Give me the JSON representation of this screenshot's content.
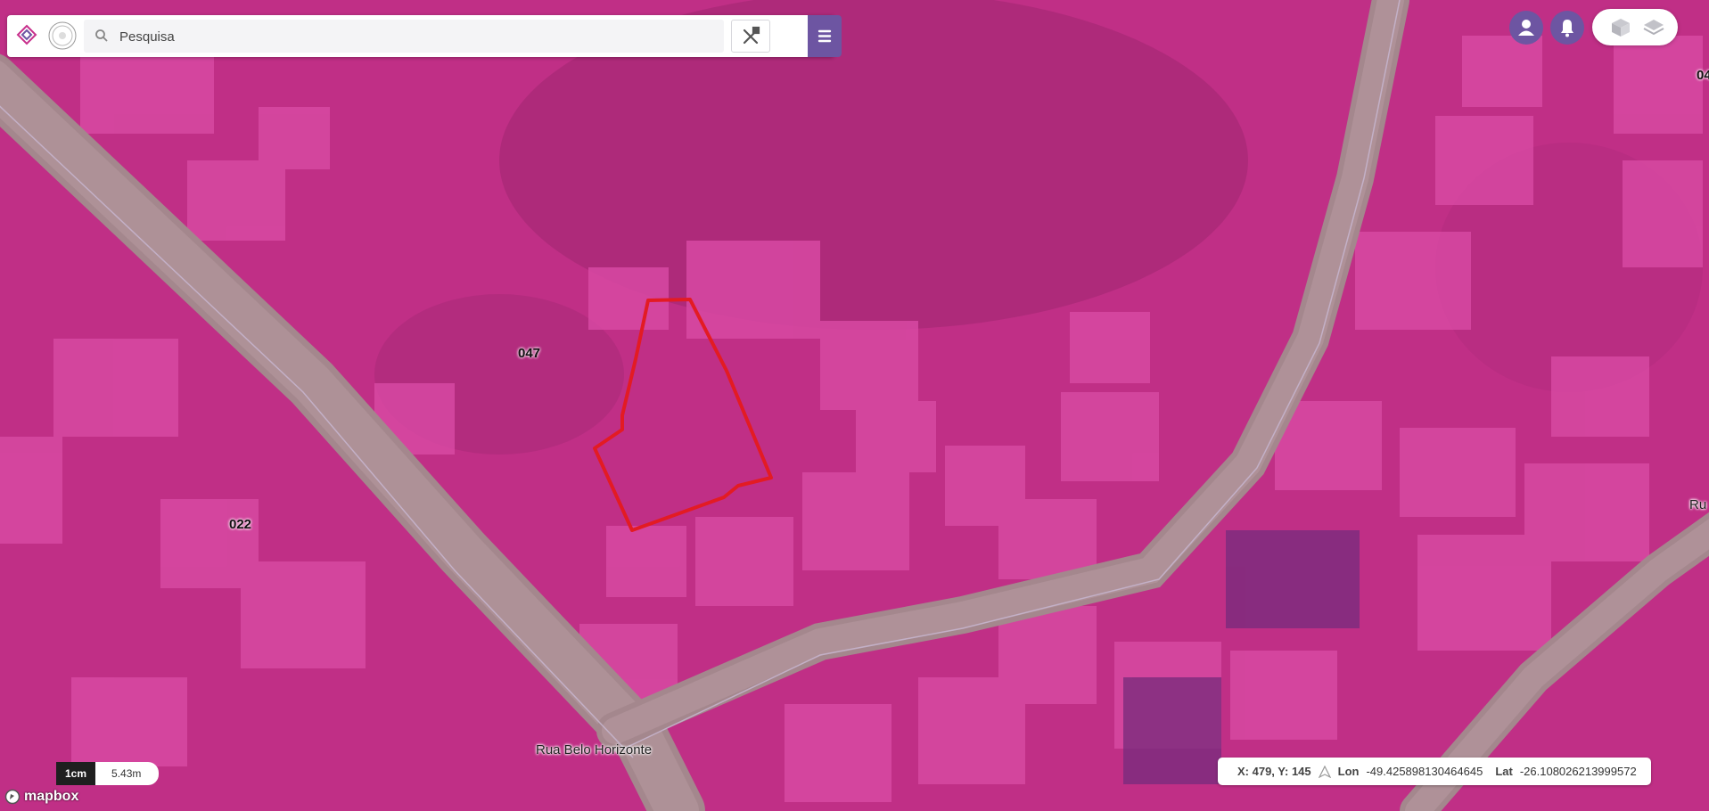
{
  "search": {
    "placeholder": "Pesquisa"
  },
  "map": {
    "parcel_labels": [
      "047",
      "022"
    ],
    "edge_labels": [
      "04",
      "Ru"
    ],
    "street_label": "Rua Belo Horizonte",
    "overlay_color": "#c8308c",
    "selection_color": "#e31b23"
  },
  "scale": {
    "unit": "1cm",
    "distance": "5.43m"
  },
  "attribution": "mapbox",
  "status": {
    "xy": "X: 479, Y: 145",
    "lon_label": "Lon",
    "lon_value": "-49.425898130464645",
    "lat_label": "Lat",
    "lat_value": "-26.108026213999572"
  },
  "colors": {
    "accent": "#6d55a2",
    "toolbar_bg": "#ffffff"
  },
  "icons": [
    "logo-icon",
    "search-icon",
    "tools-icon",
    "menu-icon",
    "user-icon",
    "bell-icon",
    "layers-3d-icon",
    "layers-icon",
    "north-arrow-icon",
    "mapbox-logo-icon"
  ]
}
